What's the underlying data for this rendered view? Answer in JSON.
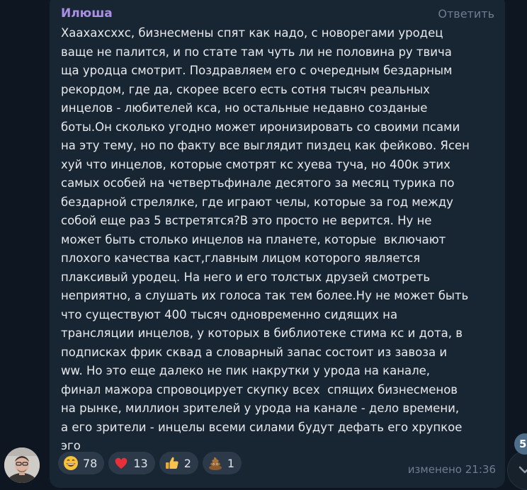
{
  "message": {
    "sender": "Илюша",
    "reply_label": "Ответить",
    "text": "Хаахахсххс, бизнесмены спят как надо, с новорегами уродец\nваще не палится, и по стате там чуть ли не половина ру твича\nща уродца смотрит. Поздравляем его с очередным бездарным\nрекордом, где да, скорее всего есть сотня тысяч реальных\nинцелов - любителей кса, но остальные недавно созданые\nботы.Он сколько угодно может иронизировать со своими псами\nна эту тему, но по факту все выглядит пиздец как фейково. Ясен\nхуй что инцелов, которые смотрят кс хуева туча, но 400к этих\nсамых особей на четвертьфинале десятого за месяц турика по\nбездарной стрелялке, где играют челы, которые за год между\nсобой еще раз 5 встретятся?В это просто не верится. Ну не\nможет быть столько инцелов на планете, которые  включают\nплохого качества каст,главным лицом которого является\nплаксивый уродец. На него и его толстых друзей смотреть\nнеприятно, а слушать их голоса так тем более.Ну не может быть\nчто существуют 400 тысяч одновременно сидящих на\nтрансляции инцелов, у которых в библиотеке стима кс и дота, в\nподписках фрик сквад а словарный запас состоит из завоза и\nww. Но это еще далеко не пик накрутки у урода на канале,\nфинал мажора спровоцирует скупку всех  спящих бизнесменов\nна рынке, миллион зрителей у урода на канале - дело времени,\nа его зрители - инцелы всеми силами будут дефать его хрупкое\nэго",
    "edited_label": "изменено",
    "time": "21:36",
    "reactions": [
      {
        "emoji": "grinning-face",
        "count": "78"
      },
      {
        "emoji": "red-heart",
        "count": "13"
      },
      {
        "emoji": "thumbs-up",
        "count": "2"
      },
      {
        "emoji": "pile-of-poo",
        "count": "1"
      }
    ]
  },
  "scroll": {
    "unread_badge": "5"
  }
}
